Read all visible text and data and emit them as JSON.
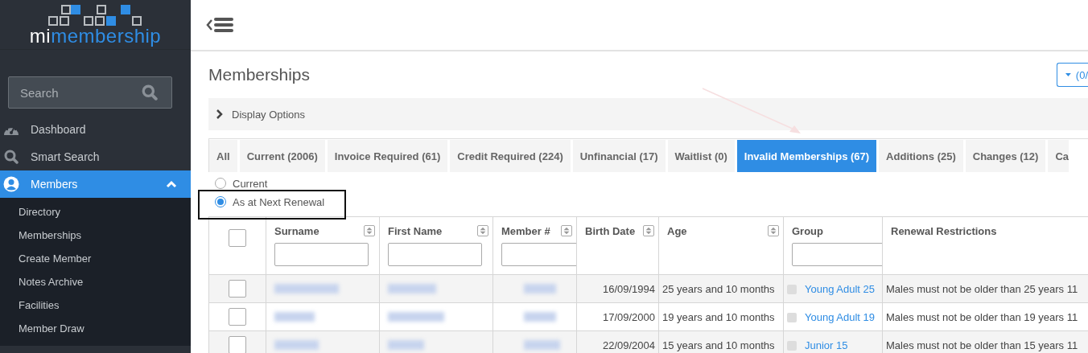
{
  "sidebar": {
    "logo": {
      "prefix": "mi",
      "name": "membership"
    },
    "search": {
      "placeholder": "Search"
    },
    "items": [
      {
        "kind": "dashboard",
        "label": "Dashboard",
        "selected": false
      },
      {
        "kind": "search",
        "label": "Smart Search",
        "selected": false
      },
      {
        "kind": "members",
        "label": "Members",
        "selected": true,
        "expanded": true,
        "children": [
          {
            "label": "Directory"
          },
          {
            "label": "Memberships"
          },
          {
            "label": "Create Member"
          },
          {
            "label": "Notes Archive"
          },
          {
            "label": "Facilities"
          },
          {
            "label": "Member Draw"
          }
        ]
      }
    ]
  },
  "page": {
    "title": "Memberships",
    "columns_button": {
      "label": "(0/"
    },
    "display_options": {
      "label": "Display Options",
      "expanded": false
    },
    "tabs": [
      {
        "label": "All",
        "selected": false
      },
      {
        "label": "Current (2006)",
        "selected": false
      },
      {
        "label": "Invoice Required (61)",
        "selected": false
      },
      {
        "label": "Credit Required (224)",
        "selected": false
      },
      {
        "label": "Unfinancial (17)",
        "selected": false
      },
      {
        "label": "Waitlist (0)",
        "selected": false
      },
      {
        "label": "Invalid Memberships (67)",
        "selected": true
      },
      {
        "label": "Additions (25)",
        "selected": false
      },
      {
        "label": "Changes (12)",
        "selected": false
      },
      {
        "label": "Ca",
        "selected": false
      }
    ],
    "radios": [
      {
        "label": "Current",
        "selected": false
      },
      {
        "label": "As at Next Renewal",
        "selected": true
      }
    ]
  },
  "table": {
    "columns": [
      {
        "kind": "select",
        "checked": false
      },
      {
        "kind": "text",
        "label": "Surname",
        "sortable": true,
        "filter": true
      },
      {
        "kind": "text",
        "label": "First Name",
        "sortable": true,
        "filter": true
      },
      {
        "kind": "text",
        "label": "Member #",
        "sortable": true,
        "filter": true
      },
      {
        "kind": "text",
        "label": "Birth Date",
        "sortable": true,
        "filter": false
      },
      {
        "kind": "text",
        "label": "Age",
        "sortable": true,
        "filter": false
      },
      {
        "kind": "text",
        "label": "Group",
        "sortable": false,
        "filter": true
      },
      {
        "kind": "text",
        "label": "Renewal Restrictions",
        "sortable": false,
        "filter": false
      }
    ],
    "rows": [
      {
        "checked": false,
        "birth_date": "16/09/1994",
        "age": "25 years and 10 months",
        "group_checked": false,
        "group": "Young Adult 25",
        "renewal_restrictions": "Males must not be older than 25 years 11"
      },
      {
        "checked": false,
        "birth_date": "17/09/2000",
        "age": "19 years and 10 months",
        "group_checked": false,
        "group": "Young Adult 19",
        "renewal_restrictions": "Males must not be older than 19 years 11"
      },
      {
        "checked": false,
        "birth_date": "22/09/2004",
        "age": "15 years and 10 months",
        "group_checked": false,
        "group": "Junior 15",
        "renewal_restrictions": "Males must not be older than 15 years 11"
      }
    ]
  }
}
